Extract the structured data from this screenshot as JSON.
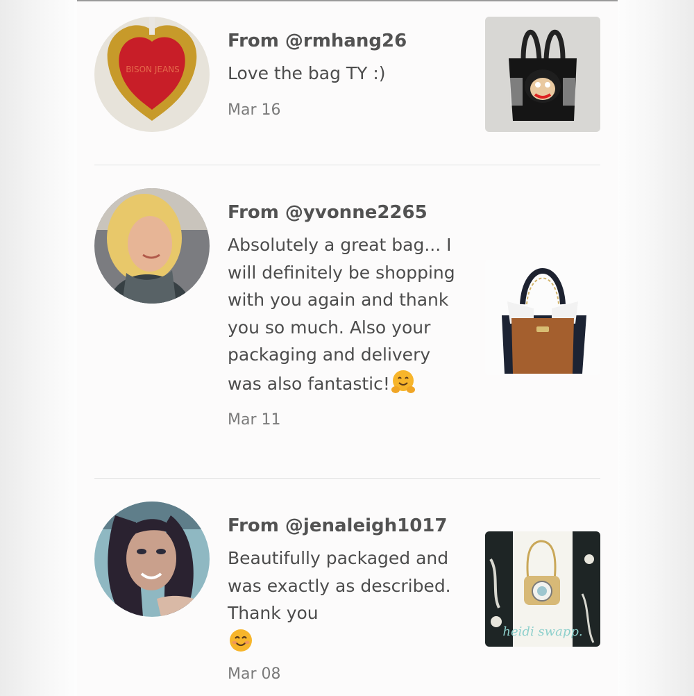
{
  "reviews": [
    {
      "from": "From @rmhang26",
      "message": "Love the bag TY :)",
      "date": "Mar 16",
      "avatar_icon": "red-tag-icon",
      "thumbnail_icon": "monkey-tote-bag-icon"
    },
    {
      "from": "From @yvonne2265",
      "message": "Absolutely a great bag... I will definitely be shopping with you again and thank you so much. Also your packaging and delivery was also fantastic!",
      "emoji": "hugging-face-emoji",
      "date": "Mar 11",
      "avatar_icon": "user-photo",
      "thumbnail_icon": "brown-handbag-icon"
    },
    {
      "from": "From @jenaleigh1017",
      "message": "Beautifully packaged and was exactly as described. Thank you",
      "emoji": "smiling-face-emoji",
      "date": "Mar 08",
      "avatar_icon": "user-photo",
      "thumbnail_icon": "camera-bag-icon",
      "thumbnail_text": "heidi swapp."
    }
  ],
  "tag_text": "BISON JEANS",
  "colors": {
    "text": "#4c4c4c",
    "date": "#7a7a7a",
    "divider": "#e1e1e1",
    "emoji": "#f7b52b"
  }
}
